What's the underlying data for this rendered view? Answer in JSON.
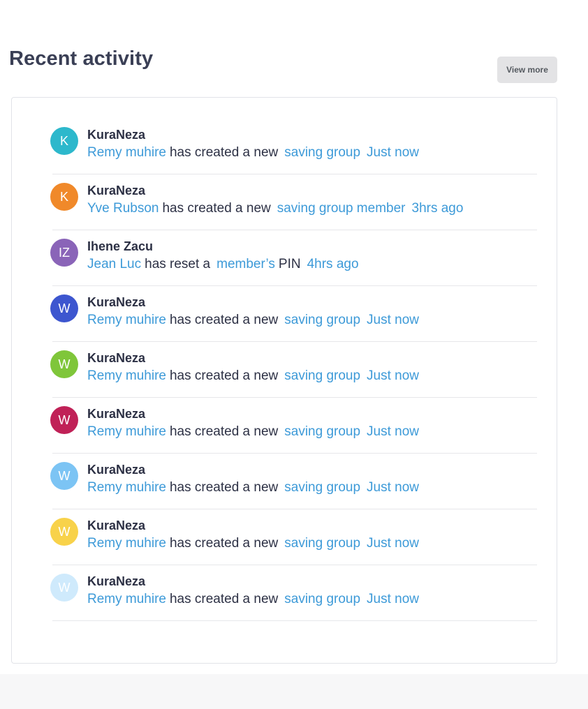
{
  "header": {
    "title": "Recent activity",
    "view_more_label": "View more"
  },
  "activities": [
    {
      "avatar_initials": "K",
      "avatar_color": "#2db8cc",
      "actor": "KuraNeza",
      "user": "Remy muhire",
      "action": "has created a new",
      "object": "saving group",
      "time": "Just now"
    },
    {
      "avatar_initials": "K",
      "avatar_color": "#f0892a",
      "actor": "KuraNeza",
      "user": "Yve Rubson",
      "action": "has created a new",
      "object": "saving group member",
      "time": "3hrs ago"
    },
    {
      "avatar_initials": "IZ",
      "avatar_color": "#8a64b8",
      "actor": "Ihene Zacu",
      "user": "Jean Luc",
      "action": "has reset a",
      "object": "member’s",
      "suffix": "PIN",
      "time": "4hrs ago"
    },
    {
      "avatar_initials": "W",
      "avatar_color": "#3d56cf",
      "actor": "KuraNeza",
      "user": "Remy muhire",
      "action": "has created a new",
      "object": "saving group",
      "time": "Just now"
    },
    {
      "avatar_initials": "W",
      "avatar_color": "#7fc63a",
      "actor": "KuraNeza",
      "user": "Remy muhire",
      "action": "has created a new",
      "object": "saving group",
      "time": "Just now"
    },
    {
      "avatar_initials": "W",
      "avatar_color": "#c02157",
      "actor": "KuraNeza",
      "user": "Remy muhire",
      "action": "has created a new",
      "object": "saving group",
      "time": "Just now"
    },
    {
      "avatar_initials": "W",
      "avatar_color": "#7cc4f4",
      "actor": "KuraNeza",
      "user": "Remy muhire",
      "action": "has created a new",
      "object": "saving group",
      "time": "Just now"
    },
    {
      "avatar_initials": "W",
      "avatar_color": "#f8d24a",
      "actor": "KuraNeza",
      "user": "Remy muhire",
      "action": "has created a new",
      "object": "saving group",
      "time": "Just now"
    },
    {
      "avatar_initials": "W",
      "avatar_color": "#cfeafc",
      "actor": "KuraNeza",
      "user": "Remy muhire",
      "action": "has created a new",
      "object": "saving group",
      "time": "Just now"
    }
  ]
}
